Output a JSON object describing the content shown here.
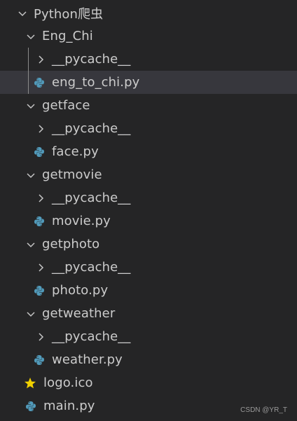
{
  "explorer": {
    "root": {
      "label": "Python爬虫",
      "expanded": true
    },
    "items": [
      {
        "label": "Eng_Chi",
        "kind": "folder",
        "expanded": true,
        "depth": 1
      },
      {
        "label": "__pycache__",
        "kind": "folder",
        "expanded": false,
        "depth": 2
      },
      {
        "label": "eng_to_chi.py",
        "kind": "python",
        "depth": 2,
        "selected": true
      },
      {
        "label": "getface",
        "kind": "folder",
        "expanded": true,
        "depth": 1
      },
      {
        "label": "__pycache__",
        "kind": "folder",
        "expanded": false,
        "depth": 2
      },
      {
        "label": "face.py",
        "kind": "python",
        "depth": 2
      },
      {
        "label": "getmovie",
        "kind": "folder",
        "expanded": true,
        "depth": 1
      },
      {
        "label": "__pycache__",
        "kind": "folder",
        "expanded": false,
        "depth": 2
      },
      {
        "label": "movie.py",
        "kind": "python",
        "depth": 2
      },
      {
        "label": "getphoto",
        "kind": "folder",
        "expanded": true,
        "depth": 1
      },
      {
        "label": "__pycache__",
        "kind": "folder",
        "expanded": false,
        "depth": 2
      },
      {
        "label": "photo.py",
        "kind": "python",
        "depth": 2
      },
      {
        "label": "getweather",
        "kind": "folder",
        "expanded": true,
        "depth": 1
      },
      {
        "label": "__pycache__",
        "kind": "folder",
        "expanded": false,
        "depth": 2
      },
      {
        "label": "weather.py",
        "kind": "python",
        "depth": 2
      },
      {
        "label": "logo.ico",
        "kind": "icon",
        "depth": 1
      },
      {
        "label": "main.py",
        "kind": "python",
        "depth": 1
      }
    ]
  },
  "watermark": "CSDN @YR_T",
  "colors": {
    "background": "#252526",
    "selected_row": "#37373d",
    "text": "#cccccc",
    "python_icon_blue": "#519aba",
    "star_icon": "#f0d000"
  },
  "icons": {
    "expanded": "chevron-down-icon",
    "collapsed": "chevron-right-icon",
    "python": "python-file-icon",
    "icon_file": "star-icon"
  }
}
